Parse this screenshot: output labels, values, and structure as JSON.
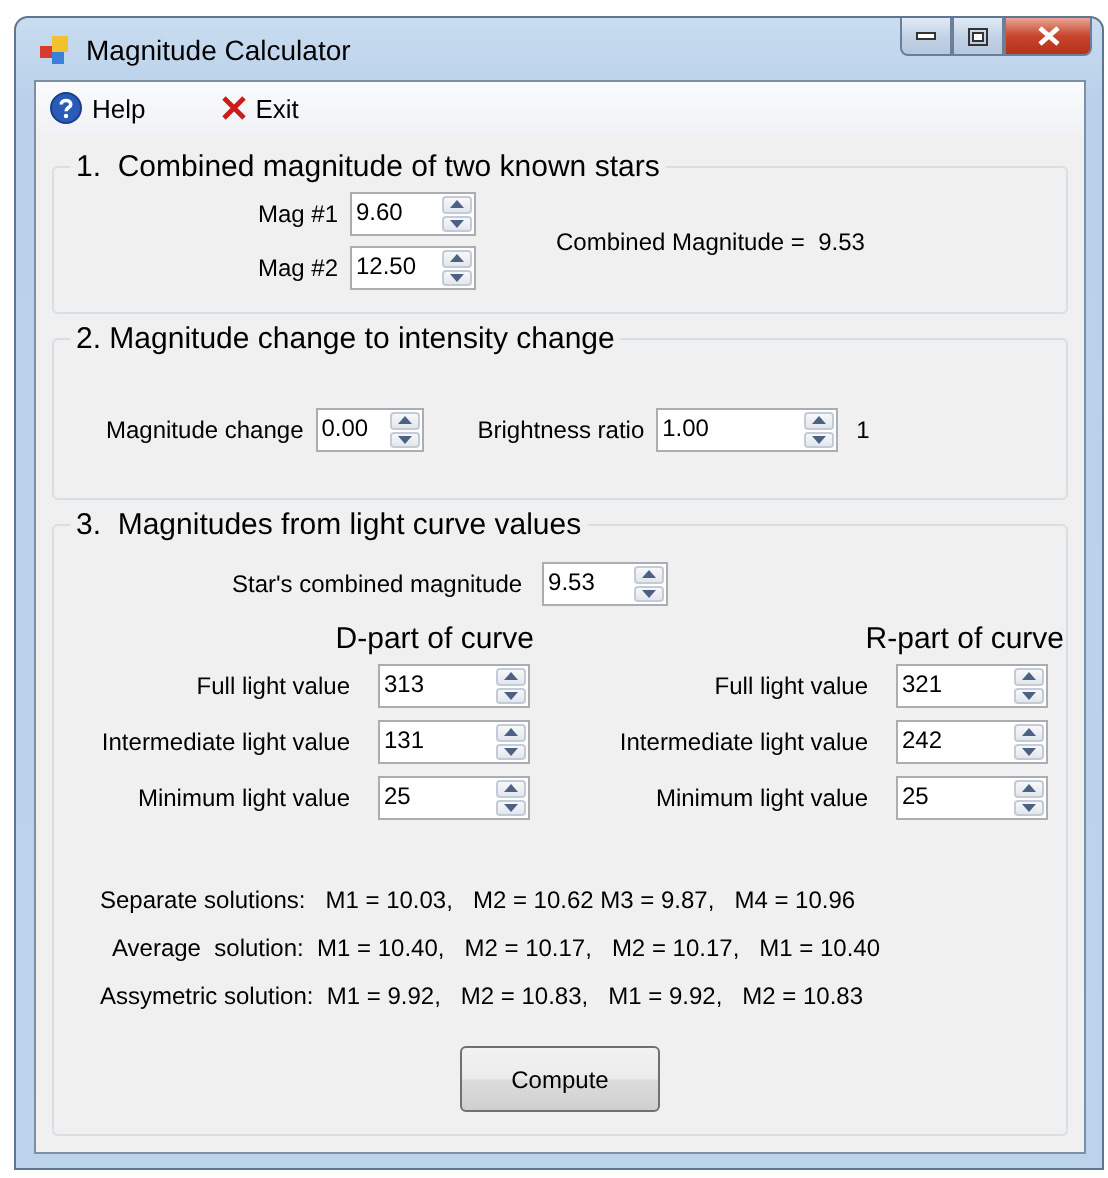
{
  "window": {
    "title": "Magnitude Calculator"
  },
  "menu": [
    {
      "label": "Help",
      "kind": "help"
    },
    {
      "label": "Exit",
      "kind": "exit"
    }
  ],
  "section_1": {
    "title": "1.  Combined magnitude of two known stars",
    "fields": [
      {
        "label": "Mag #1",
        "value": "9.60"
      },
      {
        "label": "Mag #2",
        "value": "12.50"
      }
    ],
    "result": "Combined Magnitude =  9.53"
  },
  "section_2": {
    "title": "2. Magnitude change to intensity change",
    "magnitude_change": {
      "label": "Magnitude change",
      "value": "0.00"
    },
    "brightness_ratio": {
      "label": "Brightness ratio",
      "value": "1.00"
    },
    "ratio_output": "1"
  },
  "section_3": {
    "title": "3.  Magnitudes from light curve values",
    "combined": {
      "label": "Star's combined magnitude",
      "value": "9.53"
    },
    "curves": [
      {
        "heading": "D-part of curve",
        "fields": [
          {
            "label": "Full light value",
            "value": "313"
          },
          {
            "label": "Intermediate light value",
            "value": "131"
          },
          {
            "label": "Minimum light value",
            "value": "25"
          }
        ]
      },
      {
        "heading": "R-part of curve",
        "fields": [
          {
            "label": "Full light value",
            "value": "321"
          },
          {
            "label": "Intermediate light value",
            "value": "242"
          },
          {
            "label": "Minimum light value",
            "value": "25"
          }
        ]
      }
    ],
    "solutions": [
      "Separate solutions:   M1 = 10.03,   M2 = 10.62 M3 = 9.87,   M4 = 10.96",
      "  Average  solution:  M1 = 10.40,   M2 = 10.17,   M2 = 10.17,   M1 = 10.40",
      "Assymetric solution:  M1 = 9.92,   M2 = 10.83,   M1 = 9.92,   M2 = 10.83"
    ],
    "compute_button": "Compute"
  }
}
